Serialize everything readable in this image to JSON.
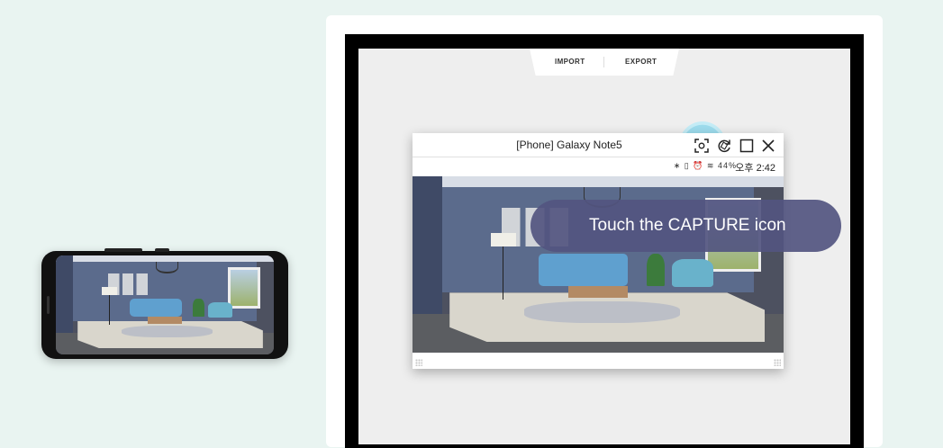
{
  "toolbar": {
    "import_label": "IMPORT",
    "export_label": "EXPORT"
  },
  "window": {
    "title": "[Phone] Galaxy Note5",
    "status_icons": "∗ ▯ ⏰ ≋ 44%",
    "time": "오후 2:42"
  },
  "tooltip": {
    "text": "Touch the CAPTURE icon"
  },
  "icons": {
    "capture": "capture-icon",
    "rotate": "rotate-icon",
    "maximize": "maximize-icon",
    "close": "close-icon"
  },
  "colors": {
    "background": "#e9f4f1",
    "tooltip": "#535580",
    "capture_highlight": "#9ddced"
  }
}
